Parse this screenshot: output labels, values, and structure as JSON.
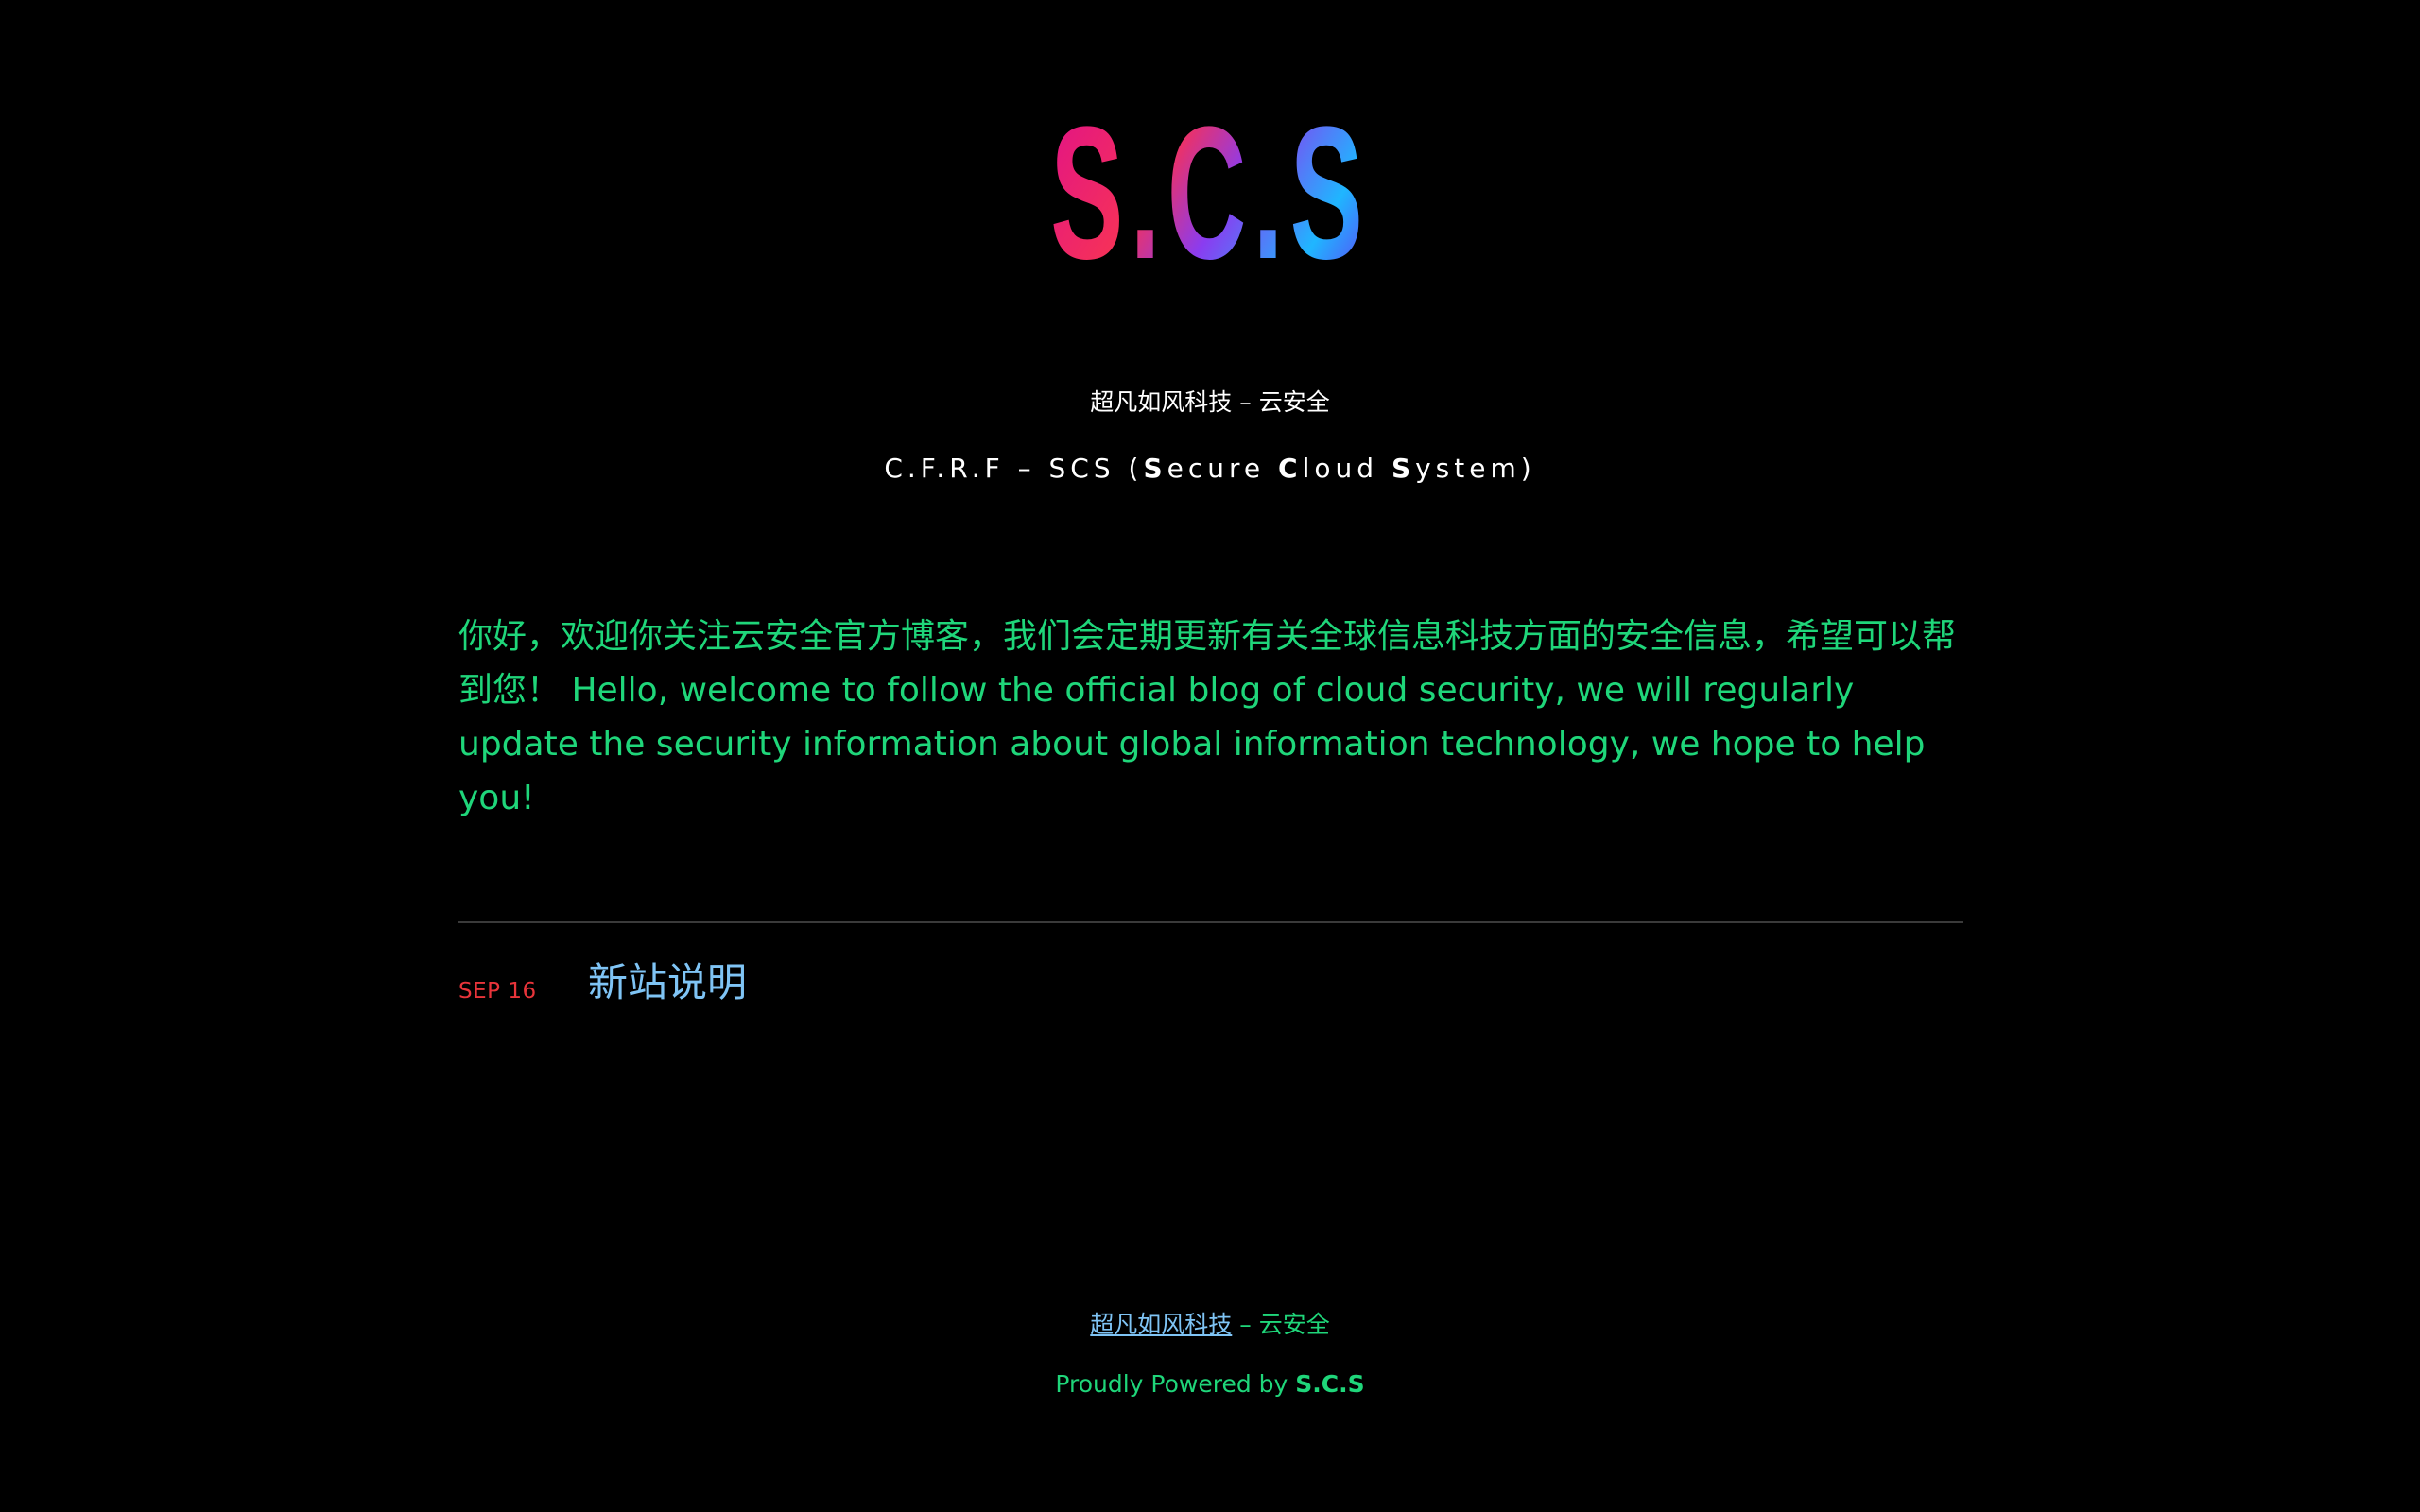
{
  "logo": {
    "text": "S.C.S"
  },
  "header": {
    "site_name": "超凡如风科技 – 云安全",
    "tagline_prefix": "C.F.R.F – SCS (",
    "tagline_s1": "S",
    "tagline_w1": "ecure ",
    "tagline_c": "C",
    "tagline_w2": "loud ",
    "tagline_s2": "S",
    "tagline_w3": "ystem)"
  },
  "intro": {
    "text": "你好，欢迎你关注云安全官方博客，我们会定期更新有关全球信息科技方面的安全信息，希望可以帮到您！ Hello, welcome to follow the official blog of cloud security, we will regularly update the security information about global information technology, we hope to help you!"
  },
  "posts": [
    {
      "date": "SEP 16",
      "title": "新站说明"
    }
  ],
  "footer": {
    "site_link": "超凡如风科技",
    "site_suffix": " – 云安全",
    "powered_prefix": "Proudly Powered by ",
    "powered_brand": "S.C.S"
  },
  "colors": {
    "background": "#000000",
    "intro_text": "#1fd67a",
    "post_date": "#e8343a",
    "link": "#7fc4f5",
    "divider": "#3a3a3a"
  }
}
